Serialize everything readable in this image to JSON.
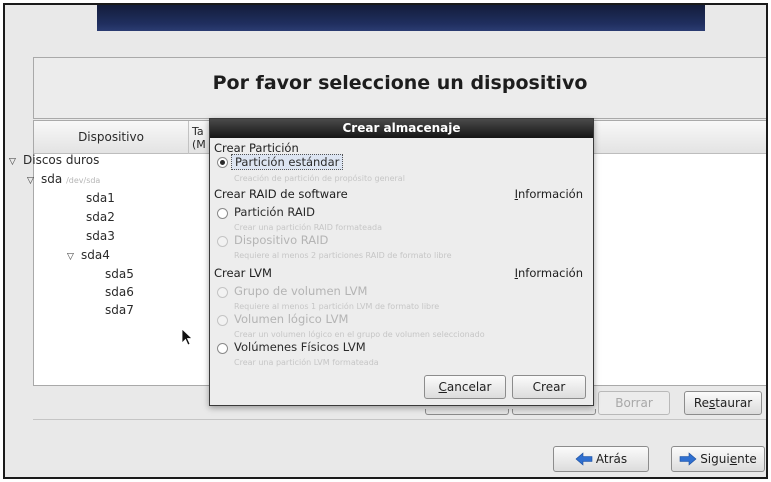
{
  "page": {
    "title": "Por favor seleccione un dispositivo"
  },
  "device_table": {
    "columns": [
      "Dispositivo",
      "Ta",
      "(M"
    ],
    "tree": [
      {
        "label": "Discos duros",
        "expanded": true,
        "level": 0
      },
      {
        "label": "sda",
        "sub": "/dev/sda",
        "expanded": true,
        "level": 1
      },
      {
        "label": "sda1",
        "level": 2
      },
      {
        "label": "sda2",
        "level": 2
      },
      {
        "label": "sda3",
        "level": 2
      },
      {
        "label": "sda4",
        "expanded": true,
        "level": 2
      },
      {
        "label": "sda5",
        "level": 3
      },
      {
        "label": "sda6",
        "level": 3
      },
      {
        "label": "sda7",
        "level": 3
      }
    ]
  },
  "actions": {
    "borrar": "Borrar",
    "restaurar_pre": "Re",
    "restaurar_u": "s",
    "restaurar_post": "taurar"
  },
  "nav": {
    "back": "Atrás",
    "next_pre": "Sigui",
    "next_u": "e",
    "next_post": "nte"
  },
  "dialog": {
    "title": "Crear almacenaje",
    "section_partition": "Crear Partición",
    "opt_standard": "Partición estándar",
    "opt_standard_desc": "Creación de partición de propósito general",
    "section_raid": "Crear RAID de software",
    "info_u": "I",
    "info_rest": "nformación",
    "opt_raid_partition": "Partición RAID",
    "opt_raid_partition_desc": "Crear una partición RAID formateada",
    "opt_raid_device": "Dispositivo RAID",
    "opt_raid_device_desc": "Requiere al menos 2 particiones RAID de formato libre",
    "section_lvm": "Crear LVM",
    "opt_lvm_group": "Grupo de volumen LVM",
    "opt_lvm_group_desc": "Requiere al menos 1 partición LVM de formato libre",
    "opt_lvm_logical": "Volumen lógico LVM",
    "opt_lvm_logical_desc": "Crear un volumen lógico en el grupo de volumen seleccionado",
    "opt_lvm_physical": "Volúmenes Físicos LVM",
    "opt_lvm_physical_desc": "Crear una partición LVM formateada",
    "cancel_u": "C",
    "cancel_rest": "ancelar",
    "create": "Crear"
  }
}
